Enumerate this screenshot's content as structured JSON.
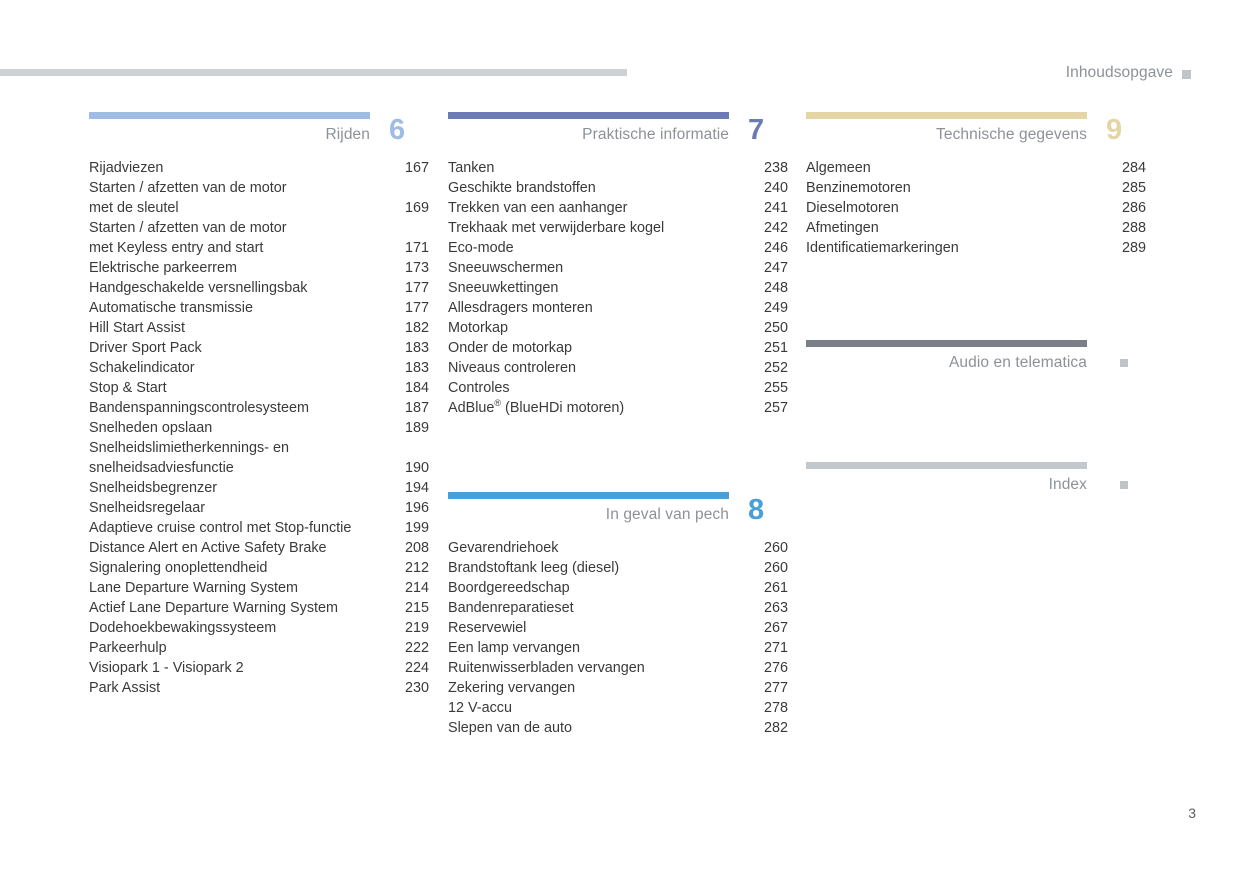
{
  "header": {
    "title": "Inhoudsopgave",
    "marker_color": "#bfc4c9",
    "rule_color": "#ccd1d6"
  },
  "footer": {
    "page_number": "3"
  },
  "columns": [
    {
      "id": "column-1",
      "sections": [
        {
          "id": "rijden",
          "title": "Rijden",
          "number": "6",
          "color": "#9fbde4",
          "entries": [
            {
              "label": "Rijadviezen",
              "page": "167"
            },
            {
              "label": "Starten / afzetten van de motor\nmet de sleutel",
              "page": "169",
              "lines": 2
            },
            {
              "label": "Starten / afzetten van de motor\nmet Keyless entry and start",
              "page": "171",
              "lines": 2
            },
            {
              "label": "Elektrische parkeerrem",
              "page": "173"
            },
            {
              "label": "Handgeschakelde versnellingsbak",
              "page": "177"
            },
            {
              "label": "Automatische transmissie",
              "page": "177"
            },
            {
              "label": "Hill Start Assist",
              "page": "182"
            },
            {
              "label": "Driver Sport Pack",
              "page": "183"
            },
            {
              "label": "Schakelindicator",
              "page": "183"
            },
            {
              "label": "Stop & Start",
              "page": "184"
            },
            {
              "label": "Bandenspanningscontrolesysteem",
              "page": "187"
            },
            {
              "label": "Snelheden opslaan",
              "page": "189"
            },
            {
              "label": "Snelheidslimietherkennings- en\nsnelheidsadviesfunctie",
              "page": "190",
              "lines": 2
            },
            {
              "label": "Snelheidsbegrenzer",
              "page": "194"
            },
            {
              "label": "Snelheidsregelaar",
              "page": "196"
            },
            {
              "label": "Adaptieve cruise control met Stop-functie",
              "page": "199"
            },
            {
              "label": "Distance Alert en Active Safety Brake",
              "page": "208"
            },
            {
              "label": "Signalering onoplettendheid",
              "page": "212"
            },
            {
              "label": "Lane Departure Warning System",
              "page": "214"
            },
            {
              "label": "Actief Lane Departure Warning System",
              "page": "215"
            },
            {
              "label": "Dodehoekbewakingssysteem",
              "page": "219"
            },
            {
              "label": "Parkeerhulp",
              "page": "222"
            },
            {
              "label": "Visiopark 1 - Visiopark 2",
              "page": "224"
            },
            {
              "label": "Park Assist",
              "page": "230"
            }
          ]
        }
      ]
    },
    {
      "id": "column-2",
      "sections": [
        {
          "id": "praktische-informatie",
          "title": "Praktische informatie",
          "number": "7",
          "color": "#6b7cb5",
          "entries": [
            {
              "label": "Tanken",
              "page": "238"
            },
            {
              "label": "Geschikte brandstoffen",
              "page": "240"
            },
            {
              "label": "Trekken van een aanhanger",
              "page": "241"
            },
            {
              "label": "Trekhaak met verwijderbare kogel",
              "page": "242"
            },
            {
              "label": "Eco-mode",
              "page": "246"
            },
            {
              "label": "Sneeuwschermen",
              "page": "247"
            },
            {
              "label": "Sneeuwkettingen",
              "page": "248"
            },
            {
              "label": "Allesdragers monteren",
              "page": "249"
            },
            {
              "label": "Motorkap",
              "page": "250"
            },
            {
              "label": "Onder de motorkap",
              "page": "251"
            },
            {
              "label": "Niveaus controleren",
              "page": "252"
            },
            {
              "label": "Controles",
              "page": "255"
            },
            {
              "label": "AdBlue",
              "label_suffix": " (BlueHDi motoren)",
              "registered": true,
              "page": "257"
            }
          ]
        },
        {
          "id": "in-geval-van-pech",
          "title": "In geval van pech",
          "number": "8",
          "color": "#4a9fd8",
          "entries": [
            {
              "label": "Gevarendriehoek",
              "page": "260"
            },
            {
              "label": "Brandstoftank leeg (diesel)",
              "page": "260"
            },
            {
              "label": "Boordgereedschap",
              "page": "261"
            },
            {
              "label": "Bandenreparatieset",
              "page": "263"
            },
            {
              "label": "Reservewiel",
              "page": "267"
            },
            {
              "label": "Een lamp vervangen",
              "page": "271"
            },
            {
              "label": "Ruitenwisserbladen vervangen",
              "page": "276"
            },
            {
              "label": "Zekering vervangen",
              "page": "277"
            },
            {
              "label": "12 V-accu",
              "page": "278"
            },
            {
              "label": "Slepen van de auto",
              "page": "282"
            }
          ]
        }
      ]
    },
    {
      "id": "column-3",
      "sections": [
        {
          "id": "technische-gegevens",
          "title": "Technische gegevens",
          "number": "9",
          "color": "#e3d5a4",
          "entries": [
            {
              "label": "Algemeen",
              "page": "284"
            },
            {
              "label": "Benzinemotoren",
              "page": "285"
            },
            {
              "label": "Dieselmotoren",
              "page": "286"
            },
            {
              "label": "Afmetingen",
              "page": "288"
            },
            {
              "label": "Identificatiemarkeringen",
              "page": "289"
            }
          ]
        },
        {
          "id": "audio-en-telematica",
          "title": "Audio en telematica",
          "number": "",
          "marker": true,
          "color": "#7b7f87",
          "entries": []
        },
        {
          "id": "index",
          "title": "Index",
          "number": "",
          "marker": true,
          "color": "#c3c8cd",
          "entries": []
        }
      ]
    }
  ]
}
